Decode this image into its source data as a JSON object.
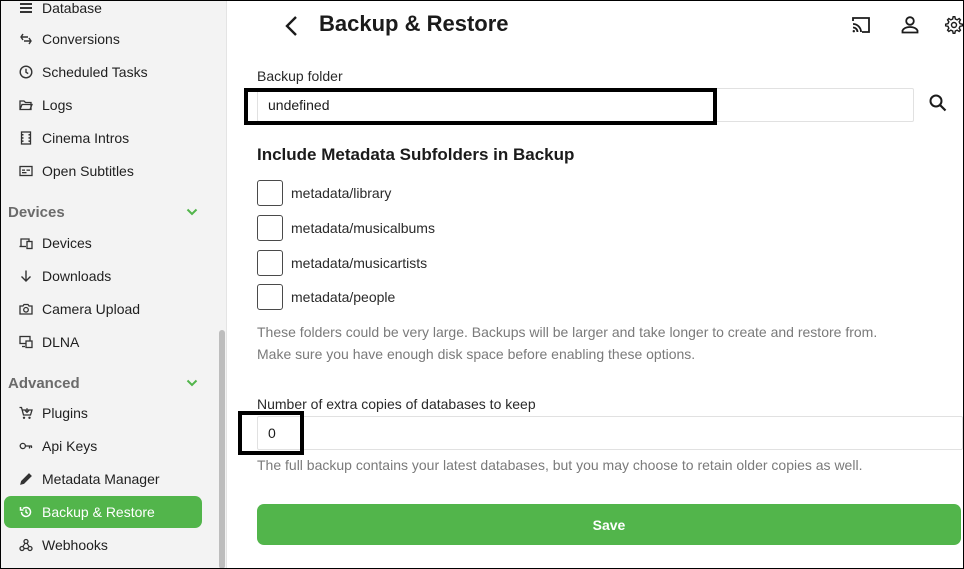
{
  "sidebar": {
    "items_top": [
      {
        "label": "Database",
        "icon": "list-icon"
      },
      {
        "label": "Conversions",
        "icon": "convert-icon"
      },
      {
        "label": "Scheduled Tasks",
        "icon": "clock-icon"
      },
      {
        "label": "Logs",
        "icon": "folder-open-icon"
      },
      {
        "label": "Cinema Intros",
        "icon": "film-icon"
      },
      {
        "label": "Open Subtitles",
        "icon": "subtitles-icon"
      }
    ],
    "section_devices": "Devices",
    "items_devices": [
      {
        "label": "Devices",
        "icon": "devices-icon"
      },
      {
        "label": "Downloads",
        "icon": "download-arrow-icon"
      },
      {
        "label": "Camera Upload",
        "icon": "camera-icon"
      },
      {
        "label": "DLNA",
        "icon": "dlna-icon"
      }
    ],
    "section_advanced": "Advanced",
    "items_advanced": [
      {
        "label": "Plugins",
        "icon": "cart-icon"
      },
      {
        "label": "Api Keys",
        "icon": "key-icon"
      },
      {
        "label": "Metadata Manager",
        "icon": "pencil-icon"
      },
      {
        "label": "Backup & Restore",
        "icon": "restore-icon",
        "active": true
      },
      {
        "label": "Webhooks",
        "icon": "webhook-icon"
      }
    ]
  },
  "header": {
    "title": "Backup & Restore"
  },
  "form": {
    "backup_folder_label": "Backup folder",
    "backup_folder_value": "undefined",
    "subfolders_heading": "Include Metadata Subfolders in Backup",
    "subfolders": [
      {
        "label": "metadata/library",
        "checked": false
      },
      {
        "label": "metadata/musicalbums",
        "checked": false
      },
      {
        "label": "metadata/musicartists",
        "checked": false
      },
      {
        "label": "metadata/people",
        "checked": false
      }
    ],
    "subfolders_help_line1": "These folders could be very large. Backups will be larger and take longer to create and restore from.",
    "subfolders_help_line2": "Make sure you have enough disk space before enabling these options.",
    "copies_label": "Number of extra copies of databases to keep",
    "copies_value": "0",
    "copies_help": "The full backup contains your latest databases, but you may choose to retain older copies as well.",
    "save_label": "Save"
  },
  "colors": {
    "accent": "#52b54b",
    "sidebar_bg": "#f3f3f3",
    "section_text": "#6b6b6b",
    "help_text": "#7a7a7a"
  }
}
